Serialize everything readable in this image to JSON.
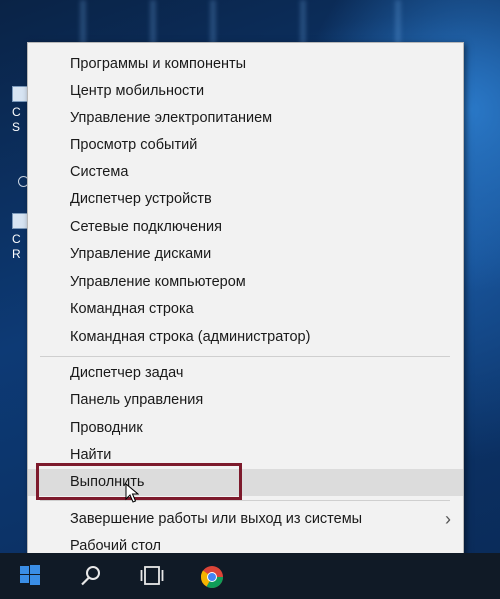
{
  "desktop_icons": [
    {
      "label": "C",
      "label2": "S"
    },
    {
      "label": "C",
      "label2": "R"
    }
  ],
  "menu": {
    "group1": [
      "Программы и компоненты",
      "Центр мобильности",
      "Управление электропитанием",
      "Просмотр событий",
      "Система",
      "Диспетчер устройств",
      "Сетевые подключения",
      "Управление дисками",
      "Управление компьютером",
      "Командная строка",
      "Командная строка (администратор)"
    ],
    "group2": [
      "Диспетчер задач",
      "Панель управления",
      "Проводник",
      "Найти",
      "Выполнить"
    ],
    "group3": [
      "Завершение работы или выход из системы",
      "Рабочий стол"
    ],
    "submenu_chevron": "›"
  },
  "taskbar": {
    "icons": [
      "windows-start-icon",
      "search-icon",
      "task-view-icon",
      "chrome-icon"
    ]
  },
  "colors": {
    "highlight_border": "#7d1a2c",
    "menu_background": "#f2f2f2",
    "taskbar": "#101a26"
  }
}
